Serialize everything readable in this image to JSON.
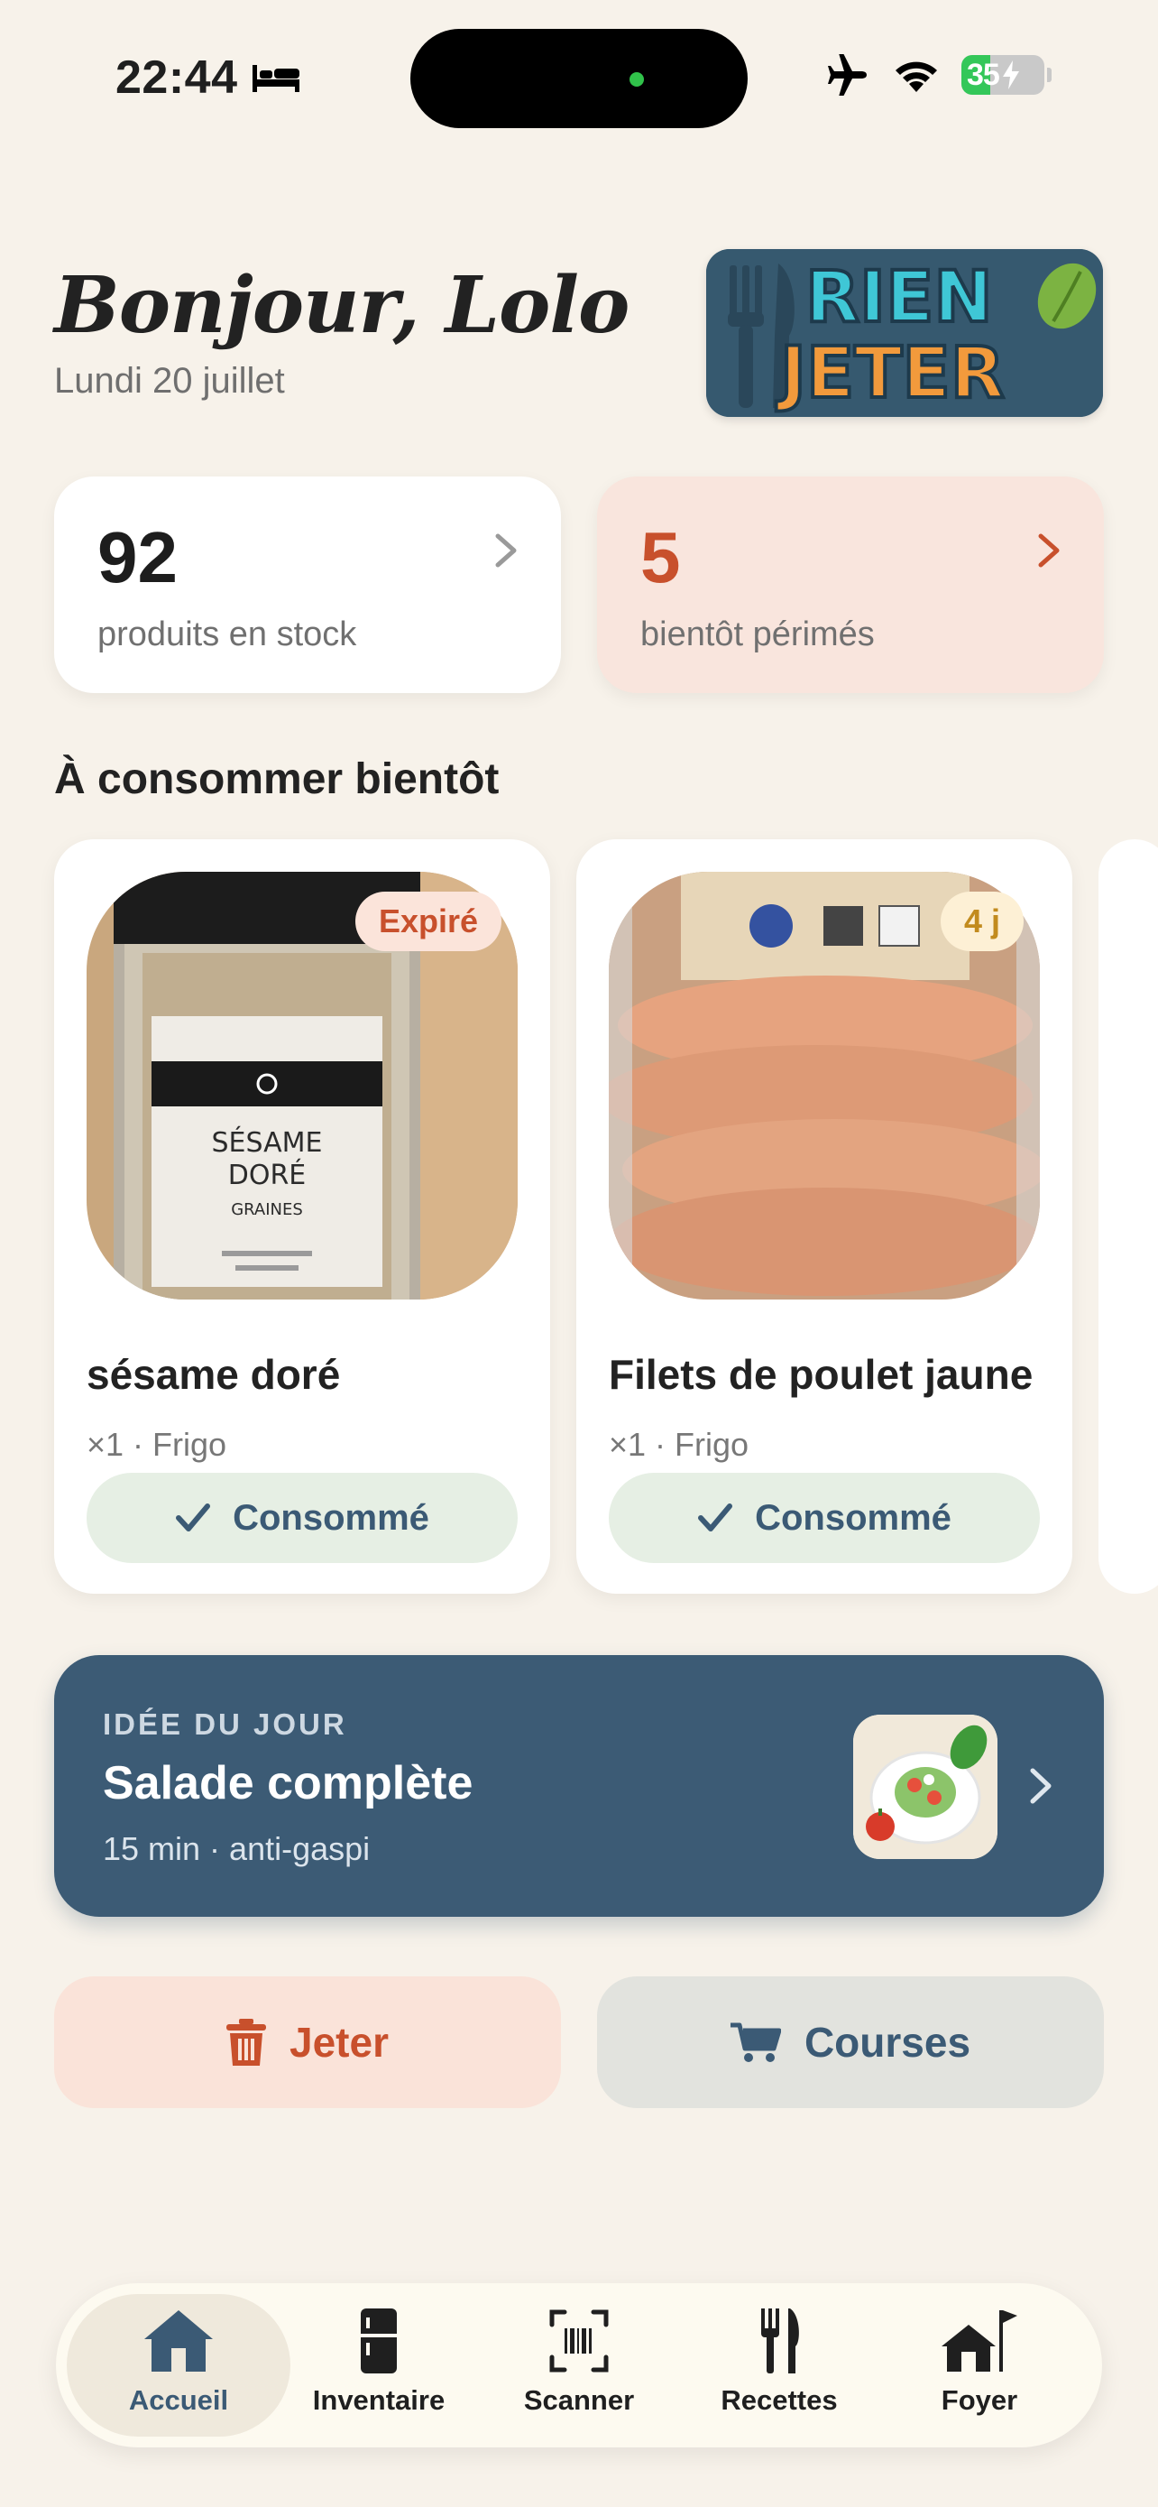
{
  "status_bar": {
    "time": "22:44",
    "battery": "35"
  },
  "header": {
    "greeting": "Bonjour, Lolo",
    "date": "Lundi 20 juillet",
    "logo_line1": "RIEN",
    "logo_line2": "JETER"
  },
  "stats": [
    {
      "value": "92",
      "label": "produits en stock"
    },
    {
      "value": "5",
      "label": "bientôt périmés"
    }
  ],
  "section_title": "À consommer bientôt",
  "products": [
    {
      "name": "sésame doré",
      "meta": "×1 · Frigo",
      "badge": "Expiré",
      "action": "Consommé",
      "label_line1": "SÉSAME",
      "label_line2": "DORÉ",
      "label_line3": "GRAINES"
    },
    {
      "name": "Filets de poulet jaune",
      "meta": "×1 · Frigo",
      "badge": "4 j",
      "action": "Consommé"
    }
  ],
  "idea": {
    "kicker": "IDÉE DU JOUR",
    "title": "Salade complète",
    "subtitle": "15 min · anti-gaspi"
  },
  "actions": {
    "throw": "Jeter",
    "shopping": "Courses"
  },
  "tabs": [
    {
      "label": "Accueil",
      "icon": "home-icon",
      "active": true
    },
    {
      "label": "Inventaire",
      "icon": "fridge-icon"
    },
    {
      "label": "Scanner",
      "icon": "barcode-scan-icon"
    },
    {
      "label": "Recettes",
      "icon": "fork-knife-icon"
    },
    {
      "label": "Foyer",
      "icon": "house-flag-icon"
    }
  ],
  "colors": {
    "background": "#f7f2ea",
    "accent_blue": "#3c5b75",
    "accent_red": "#c8502c",
    "success_bg": "#e6efe4"
  }
}
